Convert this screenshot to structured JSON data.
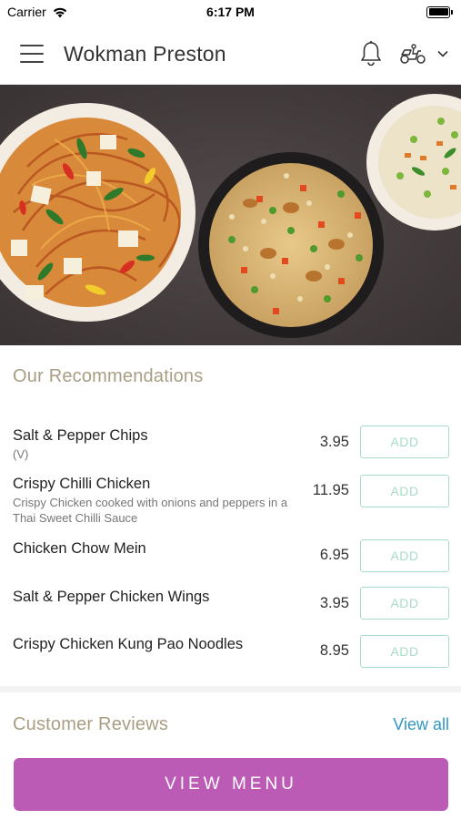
{
  "status_bar": {
    "carrier": "Carrier",
    "time": "6:17 PM"
  },
  "header": {
    "title": "Wokman Preston",
    "icons": [
      "menu-icon",
      "bell-icon",
      "scooter-icon",
      "chevron-down-icon"
    ]
  },
  "recommendations": {
    "title": "Our Recommendations",
    "items": [
      {
        "name": "Salt & Pepper Chips",
        "desc": "(V)",
        "price": "3.95",
        "add_label": "ADD"
      },
      {
        "name": "Crispy Chilli Chicken",
        "desc": "Crispy Chicken cooked with onions and peppers in a Thai Sweet Chilli Sauce",
        "price": "11.95",
        "add_label": "ADD"
      },
      {
        "name": "Chicken Chow Mein",
        "desc": "",
        "price": "6.95",
        "add_label": "ADD"
      },
      {
        "name": "Salt & Pepper Chicken Wings",
        "desc": "",
        "price": "3.95",
        "add_label": "ADD"
      },
      {
        "name": "Crispy Chicken Kung Pao Noodles",
        "desc": "",
        "price": "8.95",
        "add_label": "ADD"
      }
    ]
  },
  "reviews": {
    "title": "Customer Reviews",
    "view_all": "View all"
  },
  "cta": {
    "label": "VIEW MENU"
  },
  "colors": {
    "accent_purple": "#bb5bb6",
    "add_green": "#a8dcc6",
    "section_title": "#a99d84",
    "link_blue": "#2f97c2"
  }
}
